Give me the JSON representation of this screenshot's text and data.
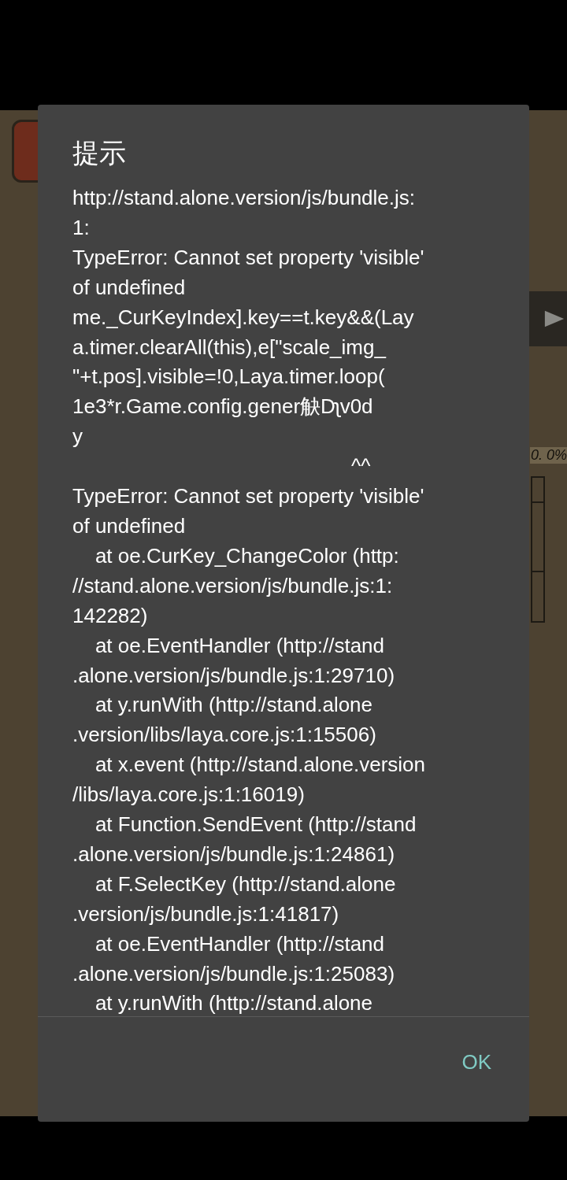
{
  "game_background": {
    "progress_text": "0. 0%"
  },
  "dialog": {
    "title": "提示",
    "message_lines": [
      "http://stand.alone.version/js/bundle.js:",
      "1:",
      "TypeError: Cannot set property 'visible'",
      "of undefined",
      "me._CurKeyIndex].key==t.key&&(Lay",
      "a.timer.clearAll(this),e[\"scale_img_",
      "\"+t.pos].visible=!0,Laya.timer.loop(",
      "1e3*r.Game.config.gener觖Dʅv0d",
      "y",
      "                                                 ^^",
      "TypeError: Cannot set property 'visible'",
      "of undefined",
      "    at oe.CurKey_ChangeColor (http:",
      "//stand.alone.version/js/bundle.js:1:",
      "142282)",
      "    at oe.EventHandler (http://stand",
      ".alone.version/js/bundle.js:1:29710)",
      "    at y.runWith (http://stand.alone",
      ".version/libs/laya.core.js:1:15506)",
      "    at x.event (http://stand.alone.version",
      "/libs/laya.core.js:1:16019)",
      "    at Function.SendEvent (http://stand",
      ".alone.version/js/bundle.js:1:24861)",
      "    at F.SelectKey (http://stand.alone",
      ".version/js/bundle.js:1:41817)",
      "    at oe.EventHandler (http://stand",
      ".alone.version/js/bundle.js:1:25083)",
      "    at y.runWith (http://stand.alone"
    ],
    "buttons": [
      "OK"
    ]
  }
}
